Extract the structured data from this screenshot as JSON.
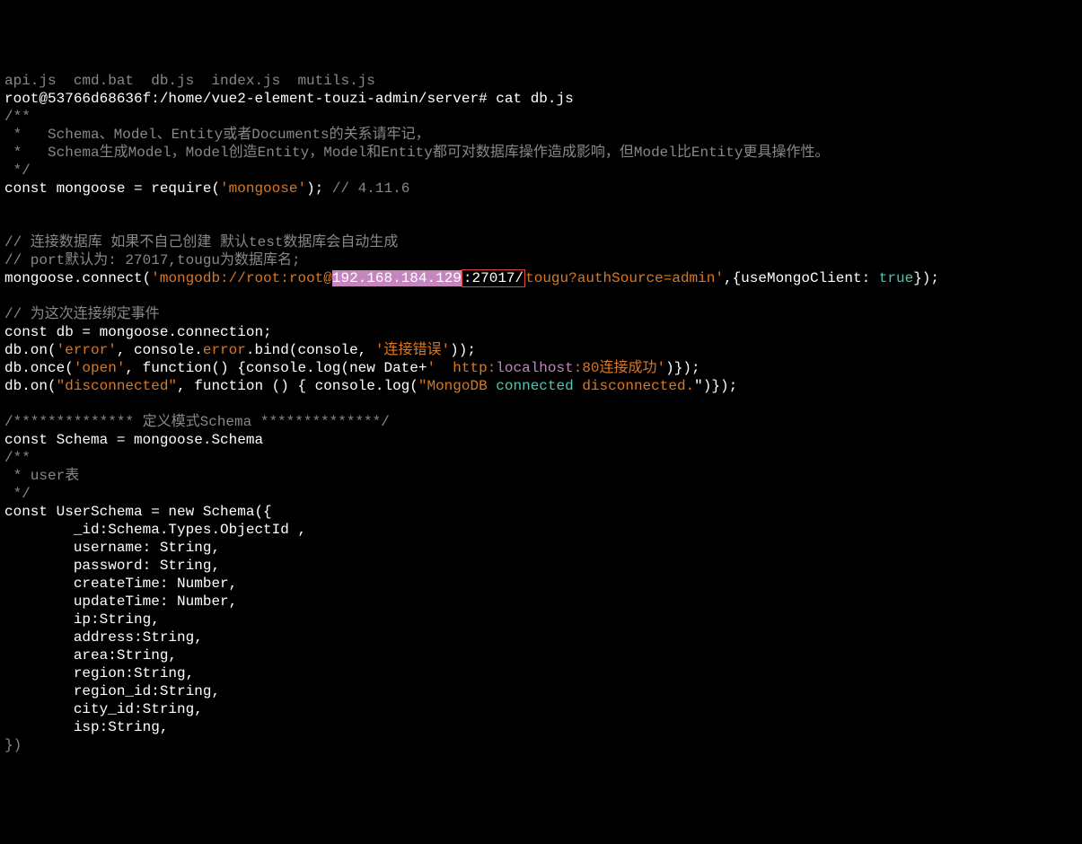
{
  "line0": "api.js  cmd.bat  db.js  index.js  mutils.js",
  "line1_prompt": "root@53766d68636f:/home/vue2-element-touzi-admin/server# ",
  "line1_cmd": "cat db.js",
  "line2": "/**",
  "line3": " *   Schema、Model、Entity或者Documents的关系请牢记，",
  "line4": " *   Schema生成Model，Model创造Entity，Model和Entity都可对数据库操作造成影响，但Model比Entity更具操作性。",
  "line5": " */",
  "line6_a": "const mongoose = require(",
  "line6_b": "'mongoose'",
  "line6_c": "); ",
  "line6_d": "// 4.11.6",
  "line8": "// 连接数据库 如果不自己创建 默认test数据库会自动生成",
  "line9": "// port默认为: 27017,tougu为数据库名;",
  "line10_a": "mongoose.connect(",
  "line10_b": "'mongodb://root:root@",
  "line10_c": "192.168.184.129",
  "line10_d": ":27017/",
  "line10_e": "tougu?authSource=admin'",
  "line10_f": ",{useMongoClient: ",
  "line10_g": "true",
  "line10_h": "});",
  "line12": "// 为这次连接绑定事件",
  "line13": "const db = mongoose.connection;",
  "line14_a": "db.on(",
  "line14_b": "'error'",
  "line14_c": ", console.",
  "line14_d": "error",
  "line14_e": ".bind(console, ",
  "line14_f": "'连接错误'",
  "line14_g": "));",
  "line15_a": "db.once(",
  "line15_b": "'open'",
  "line15_c": ", function() {console.log(new Date+",
  "line15_d": "'  http:",
  "line15_e": "localhost",
  "line15_f": ":80连接成功'",
  "line15_g": ")});",
  "line16_a": "db.on(",
  "line16_b": "\"disconnected\"",
  "line16_c": ", function () { console.log(",
  "line16_d": "\"MongoDB ",
  "line16_e": "connected",
  "line16_f": " ",
  "line16_g": "disconnected.",
  "line16_h": "\")});",
  "line18": "/************** 定义模式Schema **************/",
  "line19": "const Schema = mongoose.Schema",
  "line20": "/**",
  "line21": " * user表",
  "line22": " */",
  "line23": "const UserSchema = new Schema({",
  "line24": "        _id:Schema.Types.ObjectId ,",
  "line25": "        username: String,",
  "line26": "        password: String,",
  "line27": "        createTime: Number,",
  "line28": "        updateTime: Number,",
  "line29": "        ip:String,",
  "line30": "        address:String,",
  "line31": "        area:String,",
  "line32": "        region:String,",
  "line33": "        region_id:String,",
  "line34": "        city_id:String,",
  "line35": "        isp:String,",
  "line36": "})"
}
